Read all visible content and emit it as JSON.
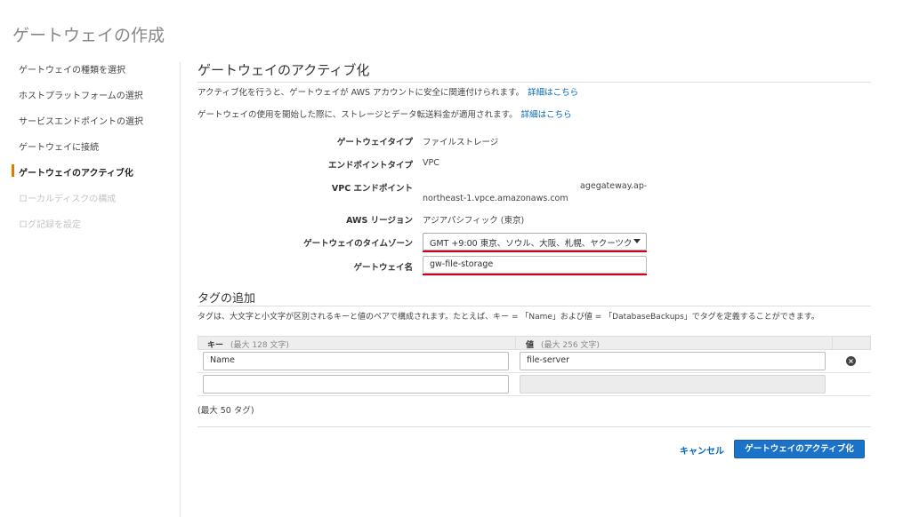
{
  "page": {
    "title": "ゲートウェイの作成"
  },
  "sidebar": {
    "items": [
      {
        "label": "ゲートウェイの種類を選択",
        "state": "normal"
      },
      {
        "label": "ホストプラットフォームの選択",
        "state": "normal"
      },
      {
        "label": "サービスエンドポイントの選択",
        "state": "normal"
      },
      {
        "label": "ゲートウェイに接続",
        "state": "normal"
      },
      {
        "label": "ゲートウェイのアクティブ化",
        "state": "active"
      },
      {
        "label": "ローカルディスクの構成",
        "state": "disabled"
      },
      {
        "label": "ログ記録を設定",
        "state": "disabled"
      }
    ],
    "accent_color": "#e07b00"
  },
  "main": {
    "section_title": "ゲートウェイのアクティブ化",
    "desc1": "アクティブ化を行うと、ゲートウェイが AWS アカウントに安全に関連付けられます。",
    "desc2": "ゲートウェイの使用を開始した際に、ストレージとデータ転送料金が適用されます。",
    "learn_more": "詳細はこちら",
    "fields": {
      "gateway_type_label": "ゲートウェイタイプ",
      "gateway_type_value": "ファイルストレージ",
      "endpoint_type_label": "エンドポイントタイプ",
      "endpoint_type_value": "VPC",
      "vpc_endpoint_label": "VPC エンドポイント",
      "vpc_endpoint_value_line1": "agegateway.ap-",
      "vpc_endpoint_value_line2": "northeast-1.vpce.amazonaws.com",
      "region_label": "AWS リージョン",
      "region_value": "アジアパシフィック (東京)",
      "timezone_label": "ゲートウェイのタイムゾーン",
      "timezone_value": "GMT +9:00 東京、ソウル、大阪、札幌、ヤクーツク",
      "name_label": "ゲートウェイ名",
      "name_value": "gw-file-storage"
    },
    "tags": {
      "title": "タグの追加",
      "description": "タグは、大文字と小文字が区別されるキーと値のペアで構成されます。たとえば、キー = 「Name」および値 = 「DatabaseBackups」でタグを定義することができます。",
      "key_header": "キー",
      "key_hint": "(最大 128 文字)",
      "value_header": "値",
      "value_hint": "(最大 256 文字)",
      "rows": [
        {
          "key": "Name",
          "value": "file-server"
        },
        {
          "key": "",
          "value": ""
        }
      ],
      "limit": "(最大 50 タグ)"
    },
    "highlight_color": "#d0021b"
  },
  "actions": {
    "cancel": "キャンセル",
    "activate": "ゲートウェイのアクティブ化",
    "primary_color": "#1a73c8"
  }
}
